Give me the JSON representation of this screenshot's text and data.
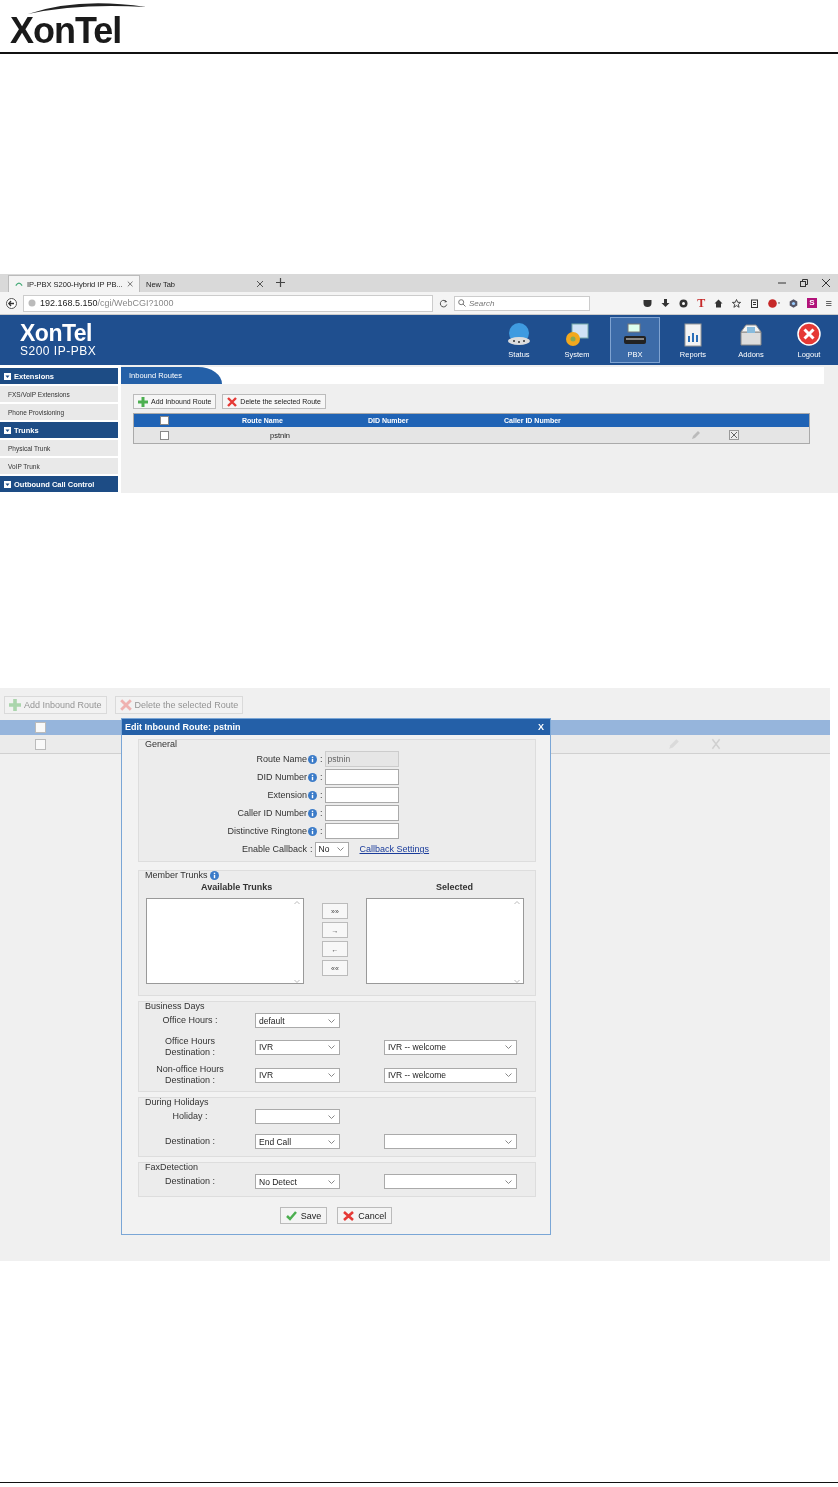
{
  "header": {
    "logo": "XonTel"
  },
  "screenshot_1": {
    "browser": {
      "tabs": [
        {
          "label": "IP-PBX S200-Hybrid IP PB...",
          "selected": true
        },
        {
          "label": "New Tab",
          "selected": false
        }
      ],
      "url_host": "192.168.5.150",
      "url_path": "/cgi/WebCGI?1000",
      "search": {
        "placeholder": "Search"
      },
      "toolbar_letters": [
        "T",
        "S"
      ],
      "menu": "≡"
    },
    "app": {
      "logo": "XonTel",
      "subtitle": "S200 IP-PBX",
      "nav": [
        {
          "label": "Status",
          "selected": false
        },
        {
          "label": "System",
          "selected": false
        },
        {
          "label": "PBX",
          "selected": true
        },
        {
          "label": "Reports",
          "selected": false
        },
        {
          "label": "Addons",
          "selected": false
        },
        {
          "label": "Logout",
          "selected": false
        }
      ],
      "sidebar": [
        {
          "label": "Extensions",
          "kind": "heading"
        },
        {
          "label": "FXS/VoIP Extensions",
          "kind": "item"
        },
        {
          "label": "Phone Provisioning",
          "kind": "item"
        },
        {
          "label": "Trunks",
          "kind": "heading"
        },
        {
          "label": "Physical Trunk",
          "kind": "item"
        },
        {
          "label": "VoIP Trunk",
          "kind": "item"
        },
        {
          "label": "Outbound Call Control",
          "kind": "heading"
        }
      ],
      "page_tab": "Inbound Routes",
      "toolbar": [
        "Add Inbound Route",
        "Delete the selected Route"
      ],
      "table": {
        "header_checked": false,
        "columns": [
          "Route Name",
          "DID Number",
          "Caller ID Number"
        ],
        "rows": [
          {
            "checked": false,
            "route_name": "pstnin"
          }
        ]
      }
    }
  },
  "screenshot_2": {
    "background": {
      "dimmed": true,
      "toolbar": [
        "Add Inbound Route",
        "Delete the selected Route"
      ],
      "header_checked": false,
      "row_checked": false
    },
    "dialog": {
      "title": "Edit Inbound Route: pstnin",
      "close": "X",
      "general": {
        "legend": "General",
        "fields": [
          {
            "label": "Route Name",
            "info": true,
            "colon": ":",
            "kind": "text",
            "value": "pstnin",
            "disabled": true
          },
          {
            "label": "DID Number",
            "info": true,
            "colon": ":",
            "kind": "text",
            "disabled": false
          },
          {
            "label": "Extension",
            "info": true,
            "colon": ":",
            "kind": "text",
            "disabled": false
          },
          {
            "label": "Caller ID Number",
            "info": true,
            "colon": ":",
            "kind": "text",
            "disabled": false
          },
          {
            "label": "Distinctive Ringtone",
            "info": true,
            "colon": ":",
            "kind": "text",
            "disabled": false
          },
          {
            "label": "Enable Callback",
            "info": false,
            "colon": ":",
            "kind": "select",
            "value": "No",
            "link": "Callback Settings",
            "disabled": false
          }
        ]
      },
      "member_trunks": {
        "legend": "Member Trunks",
        "available": "Available Trunks",
        "selected": "Selected",
        "buttons": [
          "»»",
          "→",
          "←",
          "««"
        ]
      },
      "sections": [
        {
          "legend": "Business Days",
          "rows": [
            {
              "label": "Office Hours :",
              "selects": [
                {
                  "kind": "short",
                  "value": "default"
                }
              ]
            },
            {
              "label": "Office Hours Destination :",
              "selects": [
                {
                  "kind": "short",
                  "value": "IVR"
                },
                {
                  "kind": "long",
                  "value": "IVR -- welcome"
                }
              ]
            },
            {
              "label": "Non-office Hours Destination :",
              "selects": [
                {
                  "kind": "short",
                  "value": "IVR"
                },
                {
                  "kind": "long",
                  "value": "IVR -- welcome"
                }
              ]
            }
          ]
        },
        {
          "legend": "During Holidays",
          "rows": [
            {
              "label": "Holiday :",
              "selects": [
                {
                  "kind": "short"
                }
              ]
            },
            {
              "label": "Destination :",
              "selects": [
                {
                  "kind": "short",
                  "value": "End Call"
                },
                {
                  "kind": "long"
                }
              ]
            }
          ]
        },
        {
          "legend": "FaxDetection",
          "rows": [
            {
              "label": "Destination :",
              "selects": [
                {
                  "kind": "short",
                  "value": "No Detect"
                },
                {
                  "kind": "long"
                }
              ]
            }
          ]
        }
      ],
      "buttons": [
        "Save",
        "Cancel"
      ]
    }
  }
}
